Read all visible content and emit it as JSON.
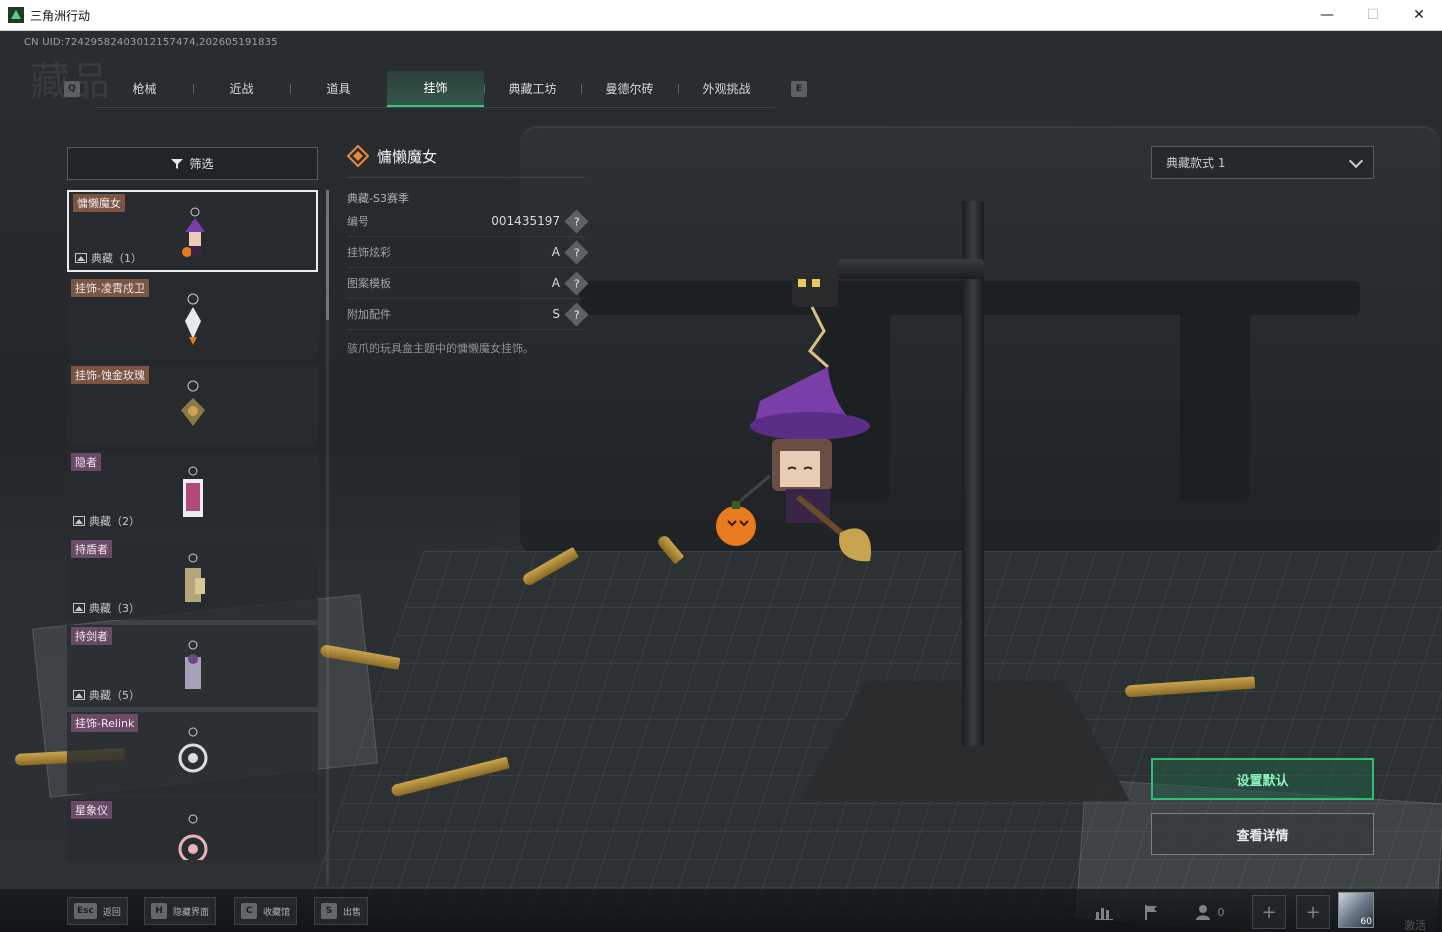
{
  "window": {
    "title": "三角洲行动",
    "minimize_glyph": "—",
    "maximize_glyph": "☐",
    "close_glyph": "✕"
  },
  "header": {
    "uid": "CN UID:7242958240301215747​4,202605191835",
    "background_title": "藏品",
    "key_prev": "Q",
    "key_next": "E",
    "tabs": [
      {
        "label": "枪械",
        "active": false
      },
      {
        "label": "近战",
        "active": false
      },
      {
        "label": "道具",
        "active": false
      },
      {
        "label": "挂饰",
        "active": true
      },
      {
        "label": "典藏工坊",
        "active": false
      },
      {
        "label": "曼德尔砖",
        "active": false
      },
      {
        "label": "外观挑战",
        "active": false
      }
    ]
  },
  "sidebar": {
    "filter_label": "筛选",
    "items": [
      {
        "tag": "慵懒魔女",
        "collection": "典藏（1）",
        "selected": true,
        "tag_color": "orange"
      },
      {
        "tag": "挂饰-凌霄戍卫",
        "collection": "",
        "selected": false,
        "tag_color": "orange"
      },
      {
        "tag": "挂饰-蚀金玫瑰",
        "collection": "",
        "selected": false,
        "tag_color": "orange"
      },
      {
        "tag": "隐者",
        "collection": "典藏（2）",
        "selected": false,
        "tag_color": "purple"
      },
      {
        "tag": "持盾者",
        "collection": "典藏（3）",
        "selected": false,
        "tag_color": "purple"
      },
      {
        "tag": "持剑者",
        "collection": "典藏（5）",
        "selected": false,
        "tag_color": "purple"
      },
      {
        "tag": "挂饰-Relink",
        "collection": "",
        "selected": false,
        "tag_color": "purple"
      },
      {
        "tag": "星象仪",
        "collection": "",
        "selected": false,
        "tag_color": "purple"
      }
    ]
  },
  "detail": {
    "name": "慵懒魔女",
    "season": "典藏-S3赛季",
    "rows": [
      {
        "key": "编号",
        "value": "001435197",
        "help": "?"
      },
      {
        "key": "挂饰炫彩",
        "value": "A",
        "help": "?"
      },
      {
        "key": "图案模板",
        "value": "A",
        "help": "?"
      },
      {
        "key": "附加配件",
        "value": "S",
        "help": "?"
      }
    ],
    "description": "骇爪的玩具盒主题中的慵懒魔女挂饰。"
  },
  "right": {
    "style_select_value": "典藏款式 1",
    "set_default_label": "设置默认",
    "view_details_label": "查看详情"
  },
  "bottom": {
    "hints": [
      {
        "key": "Esc",
        "label": "返回"
      },
      {
        "key": "H",
        "label": "隐藏界面"
      },
      {
        "key": "C",
        "label": "收藏馆"
      },
      {
        "key": "S",
        "label": "出售"
      }
    ],
    "friends_count": "0",
    "avatar_level": "60",
    "watermark": "激活"
  },
  "colors": {
    "accent_green": "#39c97d",
    "tag_purple": "#6a4b67",
    "tag_orange": "#7a5542"
  }
}
